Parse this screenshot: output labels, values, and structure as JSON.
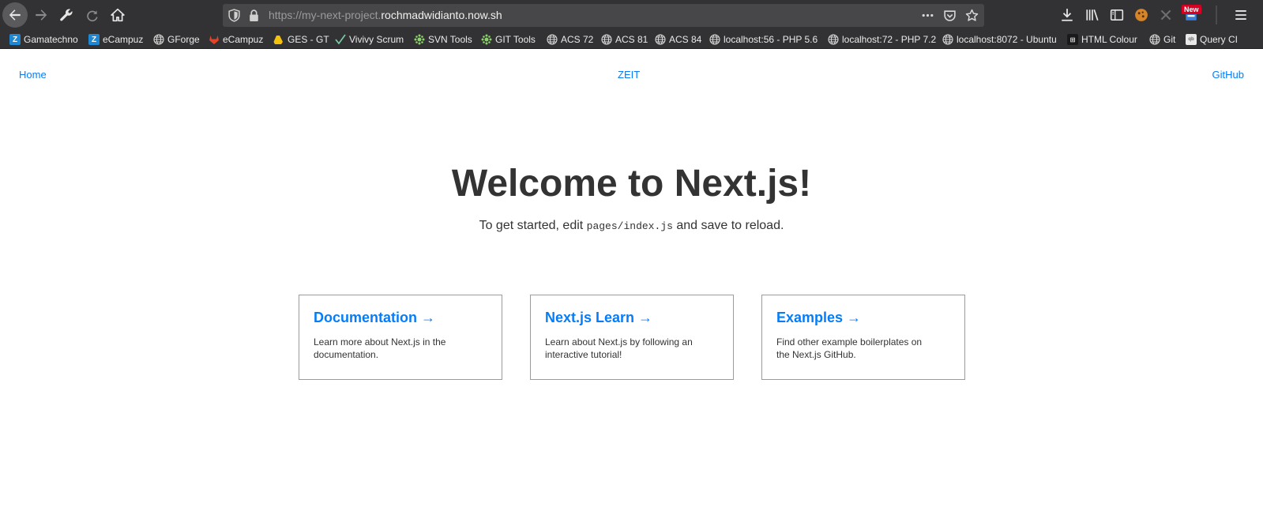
{
  "browser": {
    "url_prefix": "https://my-next-project.",
    "url_host": "rochmadwidianto.now.sh",
    "new_badge": "New",
    "bookmarks": [
      {
        "label": "Gamatechno",
        "icon": "z-icon"
      },
      {
        "label": "eCampuz",
        "icon": "z-icon"
      },
      {
        "label": "GForge",
        "icon": "globe-icon"
      },
      {
        "label": "eCampuz",
        "icon": "gitlab-icon"
      },
      {
        "label": "GES - GT",
        "icon": "folder-icon"
      },
      {
        "label": "Vivivy Scrum",
        "icon": "check-icon"
      },
      {
        "label": "SVN Tools",
        "icon": "svn-icon"
      },
      {
        "label": "GIT Tools",
        "icon": "svn-icon"
      },
      {
        "label": "ACS 72",
        "icon": "globe-icon"
      },
      {
        "label": "ACS 81",
        "icon": "globe-icon"
      },
      {
        "label": "ACS 84",
        "icon": "globe-icon"
      },
      {
        "label": "localhost:56 - PHP 5.6",
        "icon": "globe-icon"
      },
      {
        "label": "localhost:72 - PHP 7.2",
        "icon": "globe-icon"
      },
      {
        "label": "localhost:8072 - Ubuntu",
        "icon": "globe-icon"
      },
      {
        "label": "HTML Colour",
        "icon": "html-icon"
      },
      {
        "label": "Git",
        "icon": "globe-icon"
      },
      {
        "label": "Query CI",
        "icon": "query-icon"
      }
    ]
  },
  "nav": {
    "home": "Home",
    "zeit": "ZEIT",
    "github": "GitHub"
  },
  "hero": {
    "title": "Welcome to Next.js!",
    "subtitle_before": "To get started, edit ",
    "subtitle_code": "pages/index.js",
    "subtitle_after": " and save to reload."
  },
  "cards": [
    {
      "title": "Documentation →",
      "description": "Learn more about Next.js in the documentation."
    },
    {
      "title": "Next.js Learn →",
      "description": "Learn about Next.js by following an interactive tutorial!"
    },
    {
      "title": "Examples →",
      "description": "Find other example boilerplates on the Next.js GitHub."
    }
  ],
  "colors": {
    "link": "#067df7",
    "text": "#333333",
    "toolbar": "#323234"
  }
}
